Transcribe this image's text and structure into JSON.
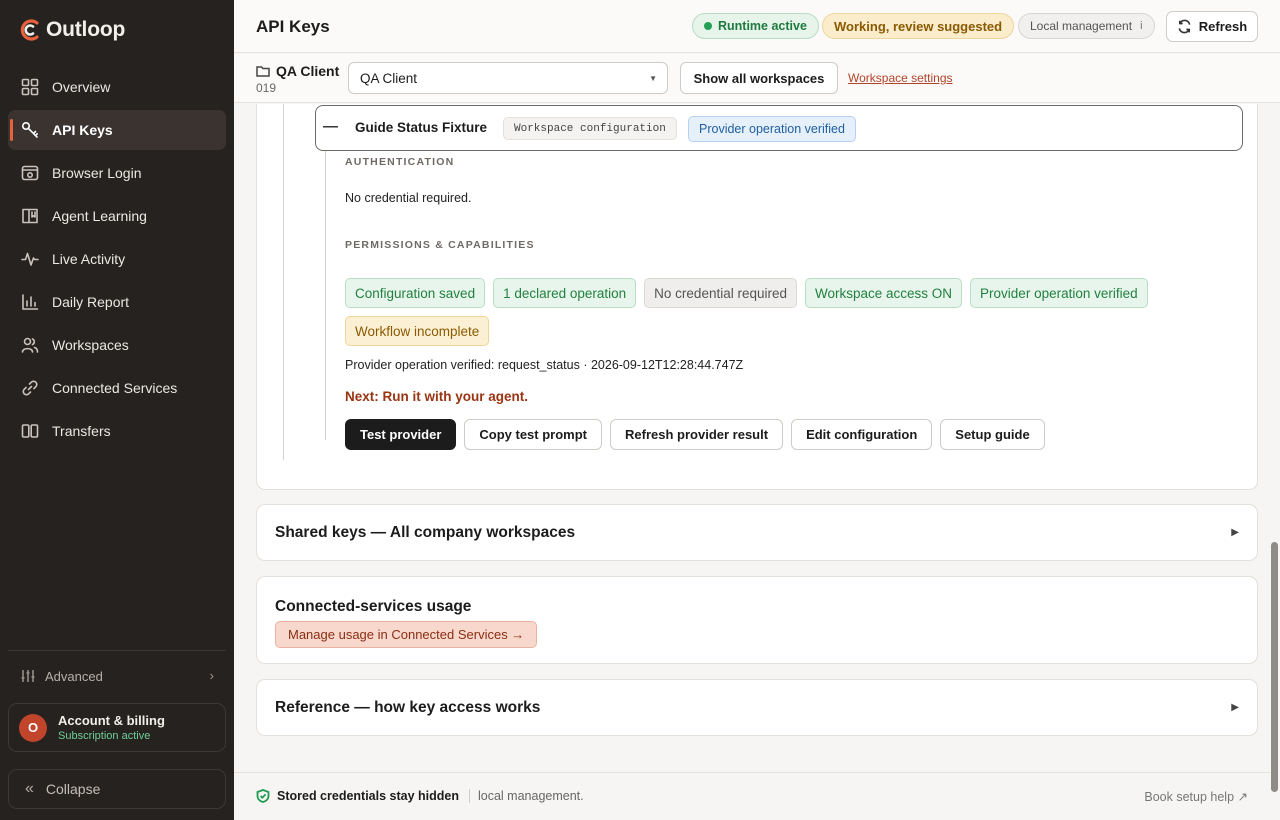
{
  "app": {
    "name": "Outloop"
  },
  "sidebar": {
    "items": [
      {
        "label": "Overview",
        "icon": "grid-icon"
      },
      {
        "label": "API Keys",
        "icon": "key-icon",
        "active": true
      },
      {
        "label": "Browser Login",
        "icon": "browser-icon"
      },
      {
        "label": "Agent Learning",
        "icon": "book-icon"
      },
      {
        "label": "Live Activity",
        "icon": "activity-icon"
      },
      {
        "label": "Daily Report",
        "icon": "bar-chart-icon"
      },
      {
        "label": "Workspaces",
        "icon": "users-icon"
      },
      {
        "label": "Connected Services",
        "icon": "link-icon"
      },
      {
        "label": "Transfers",
        "icon": "columns-icon"
      }
    ],
    "advanced_label": "Advanced",
    "account": {
      "initial": "O",
      "name": "Account & billing",
      "status": "Subscription active"
    },
    "collapse_label": "Collapse"
  },
  "header": {
    "title": "API Keys",
    "runtime_status": "Runtime active",
    "working_status": "Working, review suggested",
    "management": "Local management",
    "management_info": "i",
    "refresh_label": "Refresh"
  },
  "workspace_bar": {
    "name": "QA Client",
    "number": "019",
    "selected": "QA Client",
    "show_all_label": "Show all workspaces",
    "settings_link": "Workspace settings"
  },
  "fixture": {
    "title": "Guide Status Fixture",
    "config_tag": "Workspace configuration",
    "verified_tag": "Provider operation verified",
    "auth_label": "AUTHENTICATION",
    "auth_text": "No credential required.",
    "perms_label": "PERMISSIONS & CAPABILITIES",
    "badges": [
      {
        "label": "Configuration saved",
        "tone": "green"
      },
      {
        "label": "1 declared operation",
        "tone": "green"
      },
      {
        "label": "No credential required",
        "tone": "gray"
      },
      {
        "label": "Workspace access ON",
        "tone": "green"
      },
      {
        "label": "Provider operation verified",
        "tone": "green"
      },
      {
        "label": "Workflow incomplete",
        "tone": "amber"
      }
    ],
    "verified_line": "Provider operation verified: request_status · 2026-09-12T12:28:44.747Z",
    "next_step": "Next: Run it with your agent.",
    "actions": {
      "test": "Test provider",
      "copy": "Copy test prompt",
      "refresh": "Refresh provider result",
      "edit": "Edit configuration",
      "guide": "Setup guide"
    }
  },
  "sections": {
    "shared_keys": "Shared keys — All company workspaces",
    "usage_title": "Connected-services usage",
    "usage_button": "Manage usage in Connected Services →",
    "reference": "Reference — how key access works",
    "expand_glyph": "▶"
  },
  "footer": {
    "credentials_note": "Stored credentials stay hidden",
    "management_note": "local management.",
    "help_link": "Book setup help ↗"
  },
  "colors": {
    "accent": "#e8603c",
    "sidebar_bg": "#262220",
    "success": "#23813f",
    "warning": "#8a5a00",
    "link": "#b0432a"
  }
}
